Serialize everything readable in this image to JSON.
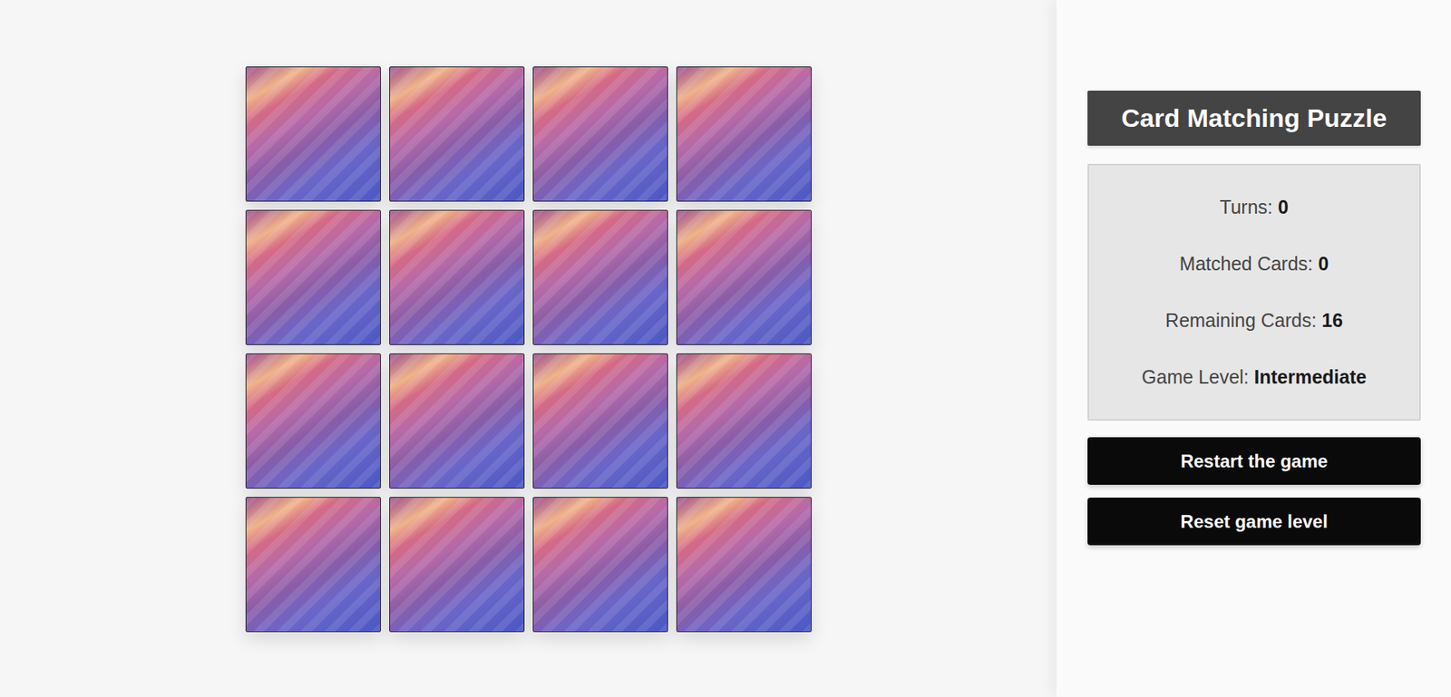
{
  "title": "Card Matching Puzzle",
  "stats": [
    {
      "label": "Turns: ",
      "value": "0"
    },
    {
      "label": "Matched Cards: ",
      "value": "0"
    },
    {
      "label": "Remaining Cards: ",
      "value": "16"
    },
    {
      "label": "Game Level: ",
      "value": "Intermediate"
    }
  ],
  "buttons": [
    "Restart the game",
    "Reset game level"
  ],
  "cards": [
    {
      "face_up": false
    },
    {
      "face_up": false
    },
    {
      "face_up": false
    },
    {
      "face_up": false
    },
    {
      "face_up": false
    },
    {
      "face_up": false
    },
    {
      "face_up": false
    },
    {
      "face_up": false
    },
    {
      "face_up": false
    },
    {
      "face_up": false
    },
    {
      "face_up": false
    },
    {
      "face_up": false
    },
    {
      "face_up": false
    },
    {
      "face_up": false
    },
    {
      "face_up": false
    },
    {
      "face_up": false
    }
  ]
}
